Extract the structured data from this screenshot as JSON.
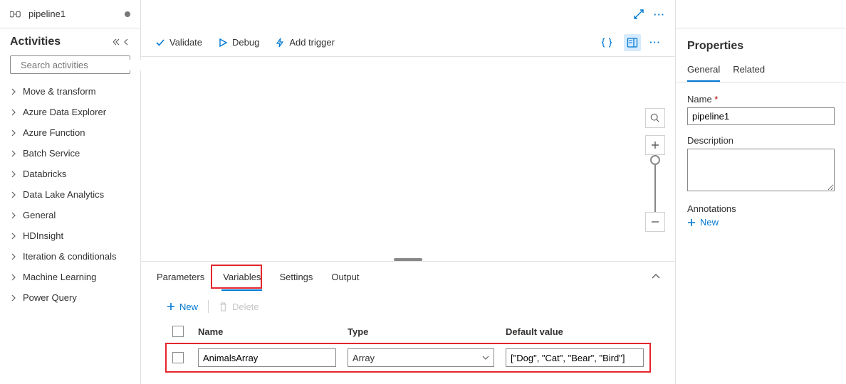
{
  "tab": {
    "title": "pipeline1"
  },
  "sidebar": {
    "title": "Activities",
    "search_placeholder": "Search activities",
    "items": [
      "Move & transform",
      "Azure Data Explorer",
      "Azure Function",
      "Batch Service",
      "Databricks",
      "Data Lake Analytics",
      "General",
      "HDInsight",
      "Iteration & conditionals",
      "Machine Learning",
      "Power Query"
    ]
  },
  "toolbar": {
    "validate": "Validate",
    "debug": "Debug",
    "add_trigger": "Add trigger"
  },
  "bottom_tabs": {
    "parameters": "Parameters",
    "variables": "Variables",
    "settings": "Settings",
    "output": "Output"
  },
  "vars": {
    "new": "New",
    "delete": "Delete",
    "cols": {
      "name": "Name",
      "type": "Type",
      "def": "Default value"
    },
    "row": {
      "name": "AnimalsArray",
      "type": "Array",
      "def": "[\"Dog\", \"Cat\", \"Bear\", \"Bird\"]"
    }
  },
  "props": {
    "title": "Properties",
    "tabs": {
      "general": "General",
      "related": "Related"
    },
    "name_label": "Name",
    "name_value": "pipeline1",
    "desc_label": "Description",
    "ann_label": "Annotations",
    "new": "New"
  }
}
